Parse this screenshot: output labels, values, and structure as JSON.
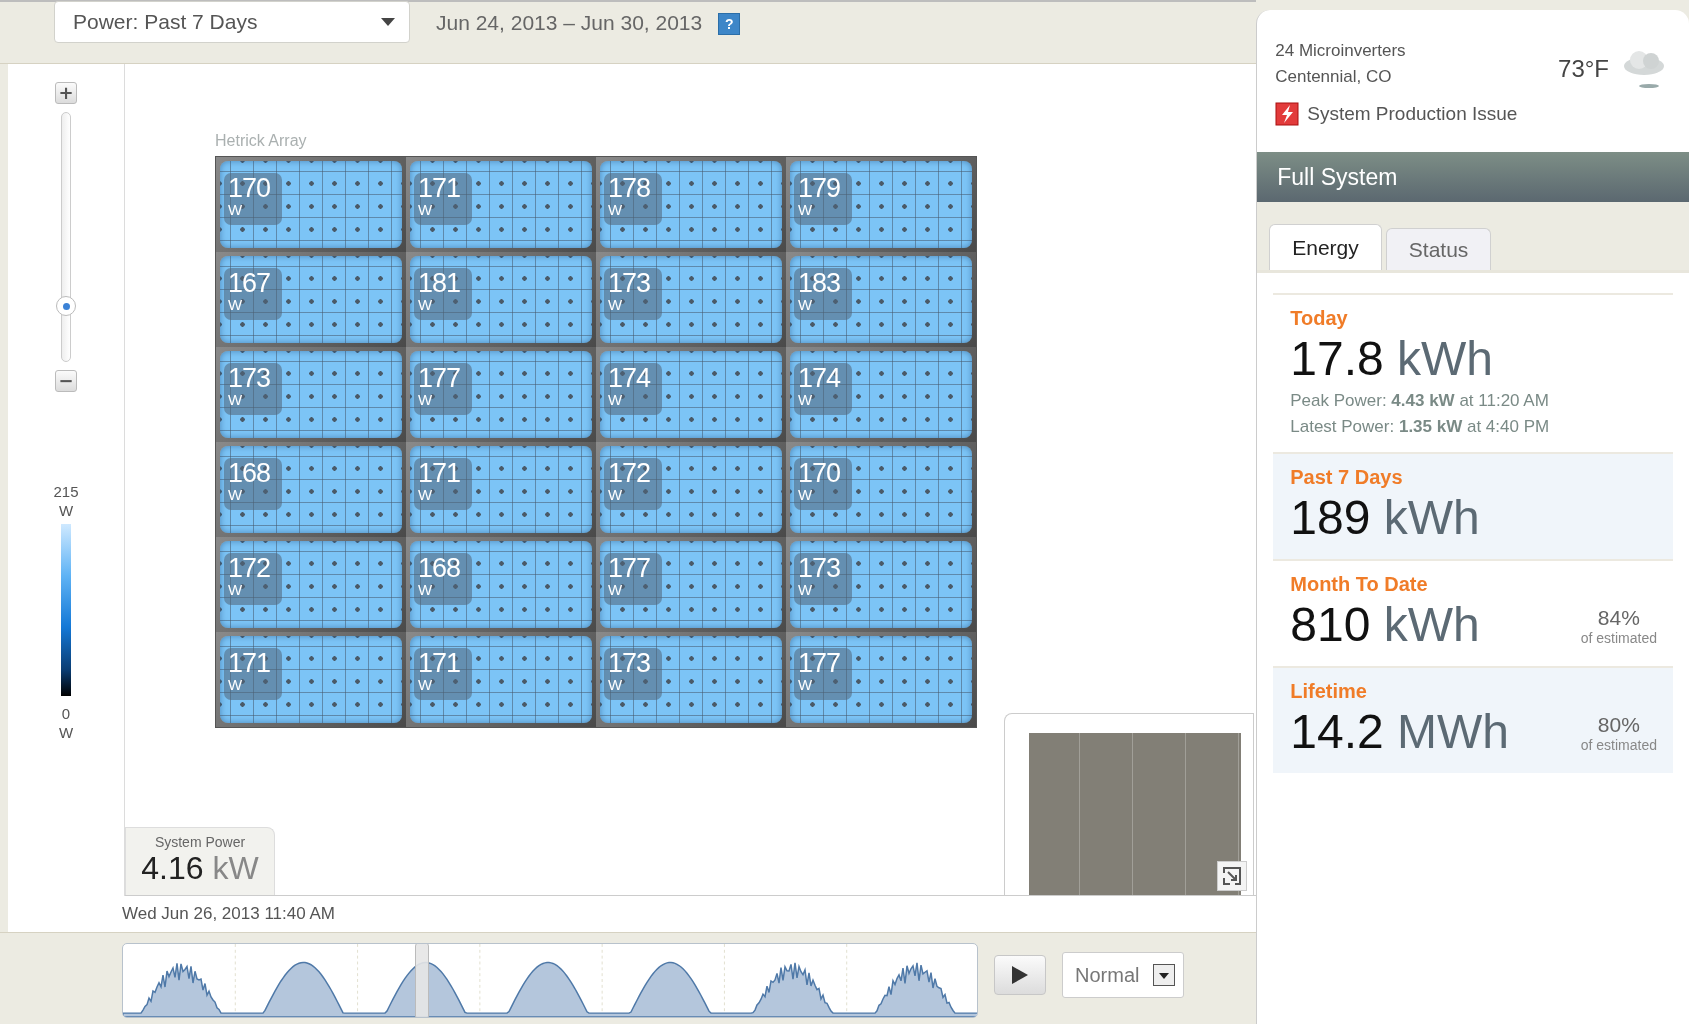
{
  "toolbar": {
    "range_select": "Power: Past 7 Days",
    "date_range": "Jun 24, 2013 – Jun 30, 2013",
    "help": "?"
  },
  "zoom": {
    "plus": "+",
    "minus": "−",
    "level": 0.2
  },
  "legend": {
    "max_value": "215",
    "max_unit": "W",
    "min_value": "0",
    "min_unit": "W"
  },
  "array": {
    "title": "Hetrick Array",
    "panels": [
      {
        "value": "170",
        "unit": "W"
      },
      {
        "value": "171",
        "unit": "W"
      },
      {
        "value": "178",
        "unit": "W"
      },
      {
        "value": "179",
        "unit": "W"
      },
      {
        "value": "167",
        "unit": "W"
      },
      {
        "value": "181",
        "unit": "W"
      },
      {
        "value": "173",
        "unit": "W"
      },
      {
        "value": "183",
        "unit": "W"
      },
      {
        "value": "173",
        "unit": "W"
      },
      {
        "value": "177",
        "unit": "W"
      },
      {
        "value": "174",
        "unit": "W"
      },
      {
        "value": "174",
        "unit": "W"
      },
      {
        "value": "168",
        "unit": "W"
      },
      {
        "value": "171",
        "unit": "W"
      },
      {
        "value": "172",
        "unit": "W"
      },
      {
        "value": "170",
        "unit": "W"
      },
      {
        "value": "172",
        "unit": "W"
      },
      {
        "value": "168",
        "unit": "W"
      },
      {
        "value": "177",
        "unit": "W"
      },
      {
        "value": "173",
        "unit": "W"
      },
      {
        "value": "171",
        "unit": "W"
      },
      {
        "value": "171",
        "unit": "W"
      },
      {
        "value": "173",
        "unit": "W"
      },
      {
        "value": "177",
        "unit": "W"
      }
    ]
  },
  "system_power": {
    "label": "System Power",
    "value": "4.16",
    "unit": "kW"
  },
  "timestamp": "Wed Jun 26, 2013 11:40 AM",
  "timeline": {
    "level": 0.35,
    "speed": "Normal"
  },
  "site": {
    "inverters": "24 Microinverters",
    "location": "Centennial, CO",
    "temperature": "73°F",
    "alert": "System Production Issue"
  },
  "section_title": "Full System",
  "tabs": [
    {
      "label": "Energy",
      "selected": true
    },
    {
      "label": "Status",
      "selected": false
    }
  ],
  "stats": [
    {
      "label": "Today",
      "value": "17.8",
      "unit": "kWh",
      "details": [
        "Peak Power: **4.43 kW** at 11:20 AM",
        "Latest Power: **1.35 kW** at 4:40 PM"
      ]
    },
    {
      "label": "Past 7 Days",
      "value": "189",
      "unit": "kWh"
    },
    {
      "label": "Month To Date",
      "value": "810",
      "unit": "kWh",
      "percent": "84%",
      "percent_note": "of estimated"
    },
    {
      "label": "Lifetime",
      "value": "14.2",
      "unit": "MWh",
      "percent": "80%",
      "percent_note": "of estimated"
    }
  ]
}
